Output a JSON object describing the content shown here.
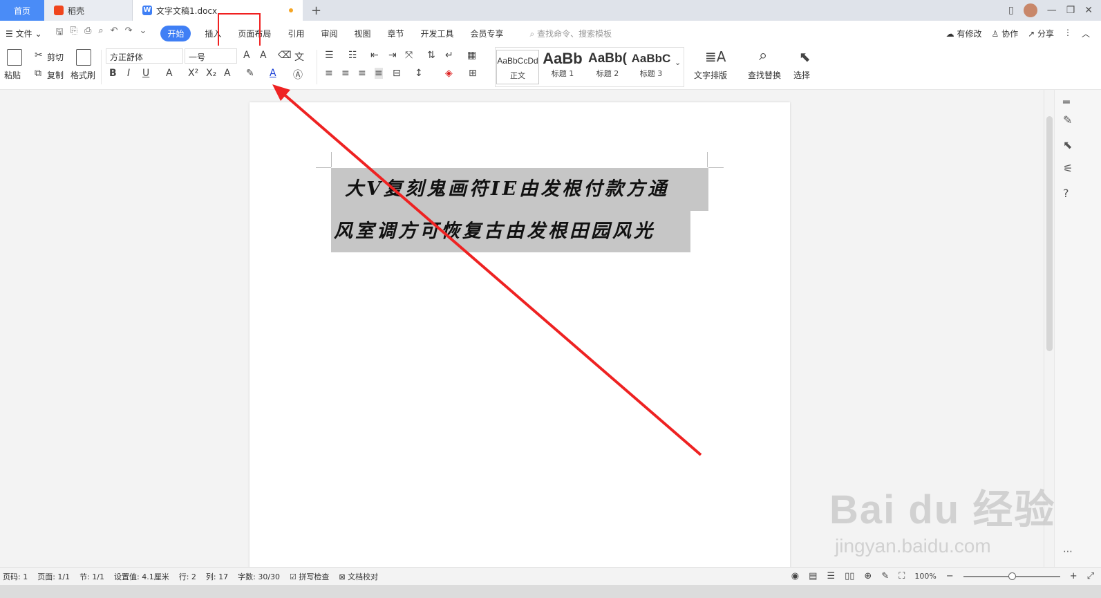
{
  "tabs": {
    "home": "首页",
    "daoke": "稻壳",
    "doc": "文字文稿1.docx",
    "add": "+"
  },
  "menu": {
    "file": "文件",
    "items": [
      "开始",
      "插入",
      "页面布局",
      "引用",
      "审阅",
      "视图",
      "章节",
      "开发工具",
      "会员专享"
    ],
    "search": "查找命令、搜索模板",
    "right": [
      "有修改",
      "协作",
      "分享"
    ]
  },
  "ribbon": {
    "paste": "粘贴",
    "cut": "剪切",
    "copy": "复制",
    "format_painter": "格式刷",
    "font_name": "方正舒体",
    "font_size": "一号",
    "styles": [
      {
        "sample": "AaBbCcDd",
        "label": "正文"
      },
      {
        "sample": "AaBb",
        "label": "标题 1"
      },
      {
        "sample": "AaBb(",
        "label": "标题 2"
      },
      {
        "sample": "AaBbC",
        "label": "标题 3"
      }
    ],
    "text_layout": "文字排版",
    "find_replace": "查找替换",
    "select": "选择"
  },
  "document": {
    "line1": "大V复刻鬼画符IE由发根付款方通",
    "line2": "风室调方可恢复古由发根田园风光"
  },
  "status": {
    "page": "页码: 1",
    "pages": "页面: 1/1",
    "section": "节: 1/1",
    "setting": "设置值: 4.1厘米",
    "row": "行: 2",
    "col": "列: 17",
    "words": "字数: 30/30",
    "spell": "拼写检查",
    "proof": "文档校对",
    "zoom": "100%",
    "zoom_level": 0.5
  },
  "watermark": {
    "big": "Bai du 经验",
    "small": "jingyan.baidu.com"
  },
  "colors": {
    "accent": "#3f7ff5",
    "highlight_box": "#f02020",
    "arrow": "#ee2222",
    "selection": "#c6c6c6"
  }
}
